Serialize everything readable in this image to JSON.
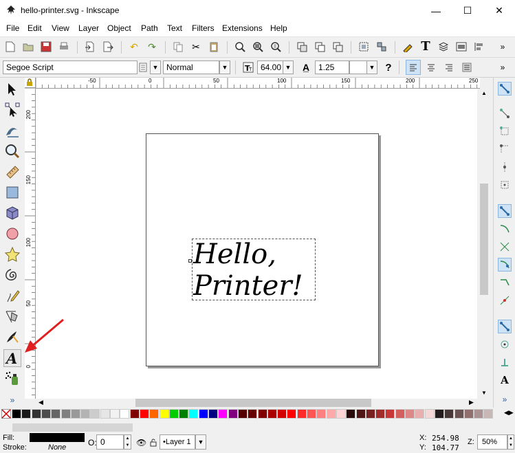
{
  "window": {
    "title": "hello-printer.svg - Inkscape",
    "minimize": "—",
    "maximize": "☐",
    "close": "✕"
  },
  "menu": [
    "File",
    "Edit",
    "View",
    "Layer",
    "Object",
    "Path",
    "Text",
    "Filters",
    "Extensions",
    "Help"
  ],
  "text_controls": {
    "font_family": "Segoe Script",
    "font_style": "Normal",
    "font_size": "64.00",
    "line_spacing": "1.25",
    "spacing_unit": "",
    "help_glyph": "?"
  },
  "ruler": {
    "top_labels": [
      "-50",
      "0",
      "50",
      "100",
      "150",
      "200",
      "250"
    ],
    "left_labels": [
      "200",
      "150",
      "100",
      "50",
      "0"
    ]
  },
  "canvas": {
    "line1": "Hello,",
    "line2": "Printer!"
  },
  "tools": [
    "selector-icon",
    "node-icon",
    "tweak-icon",
    "zoom-icon",
    "measure-icon",
    "rect-icon",
    "3dbox-icon",
    "ellipse-icon",
    "star-icon",
    "spiral-icon",
    "pencil-icon",
    "pen-icon",
    "calligraphy-icon",
    "text-icon",
    "spray-icon"
  ],
  "status": {
    "fill_label": "Fill:",
    "stroke_label": "Stroke:",
    "stroke_value": "None",
    "opacity_label": "O:",
    "opacity_value": "0",
    "layer_name": "•Layer 1",
    "x_label": "X:",
    "x_value": "254.98",
    "y_label": "Y:",
    "y_value": "104.77",
    "zoom_label": "Z:",
    "zoom_value": "50%"
  },
  "colors": {
    "palette": [
      "#000000",
      "#1a1a1a",
      "#333333",
      "#4d4d4d",
      "#666666",
      "#808080",
      "#999999",
      "#b3b3b3",
      "#cccccc",
      "#e6e6e6",
      "#f2f2f2",
      "#ffffff",
      "#800000",
      "#ff0000",
      "#ff6600",
      "#ffff00",
      "#00cc00",
      "#008000",
      "#00ffff",
      "#0000ff",
      "#000080",
      "#ff00ff",
      "#800080",
      "#550000",
      "#660000",
      "#800000",
      "#aa0000",
      "#d40000",
      "#ff0000",
      "#ff2a2a",
      "#ff5555",
      "#ff8080",
      "#ffaaaa",
      "#ffd5d5",
      "#280b0b",
      "#501616",
      "#782121",
      "#a02c2c",
      "#c83737",
      "#d35f5f",
      "#de8787",
      "#e9afaf",
      "#f4d7d7",
      "#241c1c",
      "#483737",
      "#6c5353",
      "#916f6f",
      "#ac9393",
      "#c8b7b7"
    ],
    "accent_arrow": "#e02020"
  }
}
